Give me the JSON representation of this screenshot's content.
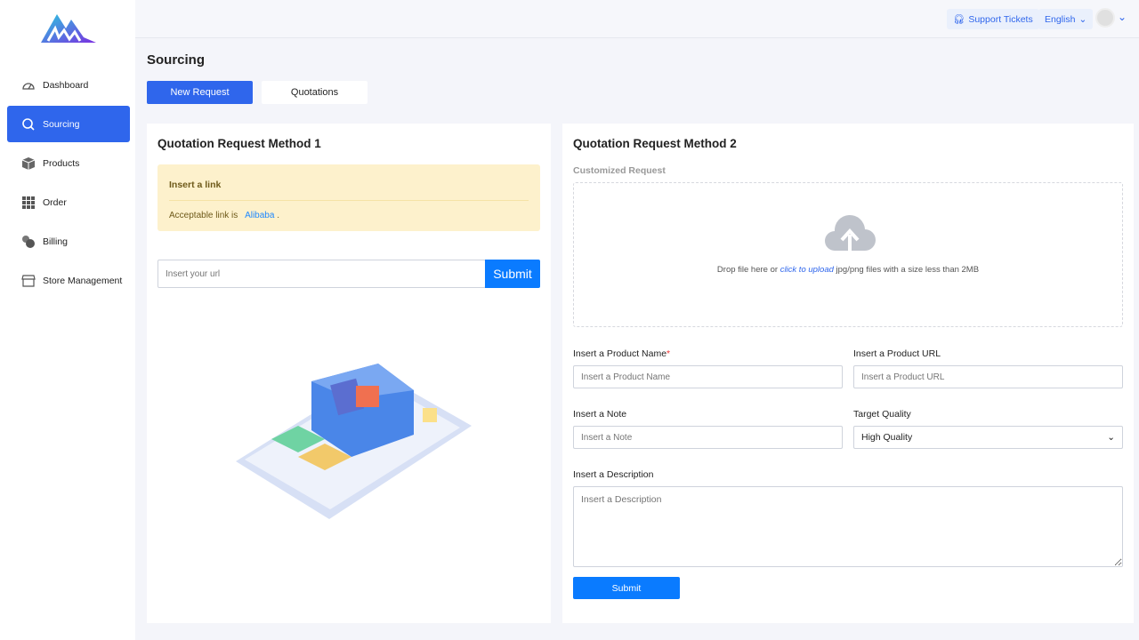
{
  "sidebar": {
    "items": [
      {
        "label": "Dashboard",
        "icon": "dashboard-gauge-icon"
      },
      {
        "label": "Sourcing",
        "icon": "search-icon",
        "active": true
      },
      {
        "label": "Products",
        "icon": "box-icon"
      },
      {
        "label": "Order",
        "icon": "grid-icon"
      },
      {
        "label": "Billing",
        "icon": "coins-icon"
      },
      {
        "label": "Store Management",
        "icon": "store-icon"
      }
    ]
  },
  "topbar": {
    "support": "Support Tickets",
    "language": "English"
  },
  "page": {
    "title": "Sourcing",
    "tabs": [
      "New Request",
      "Quotations"
    ]
  },
  "method1": {
    "title": "Quotation Request Method 1",
    "alert_title": "Insert a link",
    "alert_text": "Acceptable link is",
    "alert_link": "Alibaba",
    "alert_end": ".",
    "url_placeholder": "Insert your url",
    "submit": "Submit"
  },
  "method2": {
    "title": "Quotation Request Method 2",
    "section": "Customized Request",
    "upload": {
      "pre": "Drop file here or ",
      "link": "click to upload",
      "post": " jpg/png files with a size less than 2MB"
    },
    "product_name_label": "Insert a Product Name",
    "required_mark": "*",
    "product_name_placeholder": "Insert a Product Name",
    "product_url_label": "Insert a Product URL",
    "product_url_placeholder": "Insert a Product URL",
    "note_label": "Insert a Note",
    "note_placeholder": "Insert a Note",
    "quality_label": "Target Quality",
    "quality_value": "High Quality",
    "desc_label": "Insert a Description",
    "desc_placeholder": "Insert a Description",
    "submit": "Submit"
  },
  "colors": {
    "accent": "#2f66ec",
    "button": "#0a7bff",
    "alert_bg": "#fdf1cc"
  }
}
